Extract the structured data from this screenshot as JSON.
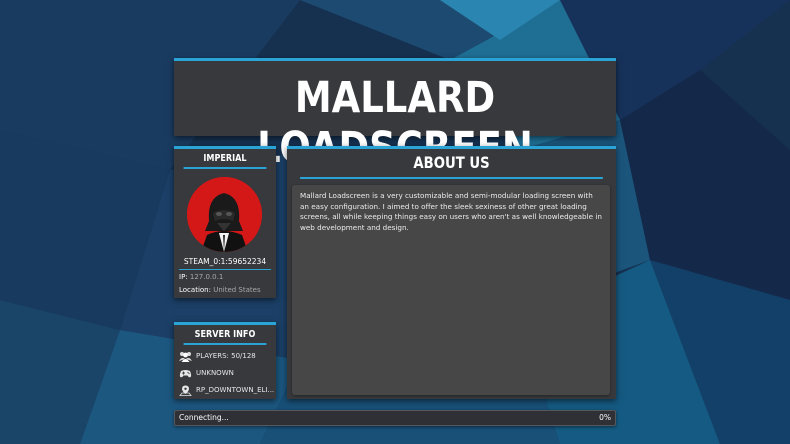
{
  "header": {
    "title": "MALLARD LOADSCREEN"
  },
  "user": {
    "group": "IMPERIAL",
    "steam_id": "STEAM_0:1:59652234",
    "ip_label": "IP:",
    "ip_value": "127.0.0.1",
    "location_label": "Location:",
    "location_value": "United States"
  },
  "server": {
    "title": "SERVER INFO",
    "players": "PLAYERS: 50/128",
    "gamemode": "UNKNOWN",
    "map": "RP_DOWNTOWN_ELI..."
  },
  "about": {
    "title": "ABOUT US",
    "body": "Mallard Loadscreen is a very customizable and semi-modular loading screen with an easy configuration. I aimed to offer the sleek sexiness of other great loading screens, all while keeping things easy on users who aren't as well knowledgeable in web development and design."
  },
  "progress": {
    "status": "Connecting...",
    "percent_label": "0%",
    "value": 0
  },
  "icons": {
    "players": "users-icon",
    "gamemode": "gamepad-icon",
    "map": "map-marker-icon"
  },
  "colors": {
    "accent": "#2aa3d6",
    "panel": "#37393d",
    "avatar_bg": "#d41818"
  }
}
